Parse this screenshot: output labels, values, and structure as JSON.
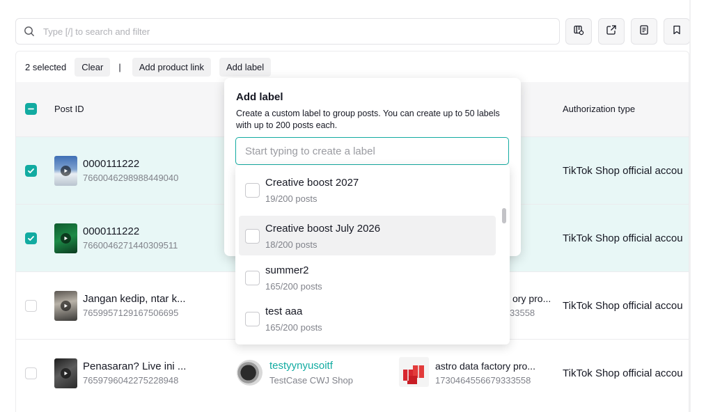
{
  "search": {
    "placeholder": "Type [/] to search and filter"
  },
  "toolbar_icons": [
    "column-settings-icon",
    "export-icon",
    "document-icon",
    "bookmark-icon"
  ],
  "action_bar": {
    "selected_text": "2 selected",
    "clear_label": "Clear",
    "separator": "|",
    "add_product_link_label": "Add product link",
    "add_label_label": "Add label"
  },
  "table": {
    "headers": {
      "post_id": "Post ID",
      "authorization_type": "Authorization type"
    },
    "rows": [
      {
        "selected": true,
        "title": "0000111222",
        "post_id": "7660046298988449040",
        "authorization": "TikTok Shop official accou",
        "creator_name": "",
        "creator_shop": "",
        "product_name": "",
        "product_id": ""
      },
      {
        "selected": true,
        "title": "0000111222",
        "post_id": "7660046271440309511",
        "authorization": "TikTok Shop official accou",
        "creator_name": "",
        "creator_shop": "",
        "product_name": "",
        "product_id": ""
      },
      {
        "selected": false,
        "title": "Jangan kedip, ntar k...",
        "post_id": "7659957129167506695",
        "authorization": "TikTok Shop official accou",
        "creator_name": "",
        "creator_shop": "",
        "product_name": "ory pro...",
        "product_id": "33558"
      },
      {
        "selected": false,
        "title": "Penasaran? Live ini ...",
        "post_id": "7659796042275228948",
        "authorization": "TikTok Shop official accou",
        "creator_name": "testyynyusoitf",
        "creator_shop": "TestCase CWJ Shop",
        "product_name": "astro data factory pro...",
        "product_id": "1730464556679333558"
      }
    ]
  },
  "add_label_popover": {
    "title": "Add label",
    "description": "Create a custom label to group posts. You can create up to 50 labels with up to 200 posts each.",
    "input_placeholder": "Start typing to create a label",
    "options": [
      {
        "name": "Creative boost 2027",
        "count": "19/200 posts",
        "highlighted": false
      },
      {
        "name": "Creative boost July 2026",
        "count": "18/200 posts",
        "highlighted": true
      },
      {
        "name": "summer2",
        "count": "165/200 posts",
        "highlighted": false
      },
      {
        "name": "test aaa",
        "count": "165/200 posts",
        "highlighted": false
      }
    ]
  },
  "colors": {
    "accent": "#12aba1",
    "selected_row": "#e8f7f6",
    "header_bg": "#f6f6f7",
    "link": "#12aba1"
  }
}
